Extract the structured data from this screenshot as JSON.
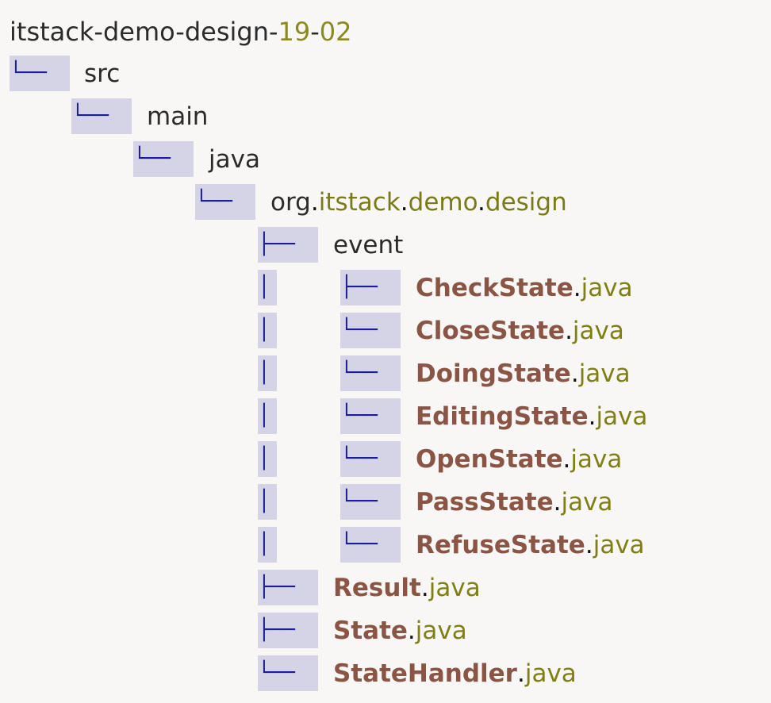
{
  "root": {
    "name": "itstack-demo-design-",
    "parts": [
      "19",
      "-",
      "02"
    ]
  },
  "connectors": {
    "last": "└──",
    "branch": "├──",
    "pipe": "│"
  },
  "colors": {
    "segment_bg": "#d4d4e6",
    "connector": "#1d1d95",
    "class_name": "#8a5545",
    "extension": "#7f7f14",
    "text": "#2b2b2b"
  },
  "tree": {
    "src": "src",
    "main": "main",
    "java": "java",
    "package": {
      "p0": "org",
      "p1": "itstack",
      "p2": "demo",
      "p3": "design",
      "dot": "."
    },
    "event": "event",
    "event_files": [
      {
        "name": "CheckState",
        "ext": "java"
      },
      {
        "name": "CloseState",
        "ext": "java"
      },
      {
        "name": "DoingState",
        "ext": "java"
      },
      {
        "name": "EditingState",
        "ext": "java"
      },
      {
        "name": "OpenState",
        "ext": "java"
      },
      {
        "name": "PassState",
        "ext": "java"
      },
      {
        "name": "RefuseState",
        "ext": "java"
      }
    ],
    "files": [
      {
        "name": "Result",
        "ext": "java"
      },
      {
        "name": "State",
        "ext": "java"
      },
      {
        "name": "StateHandler",
        "ext": "java"
      }
    ]
  }
}
